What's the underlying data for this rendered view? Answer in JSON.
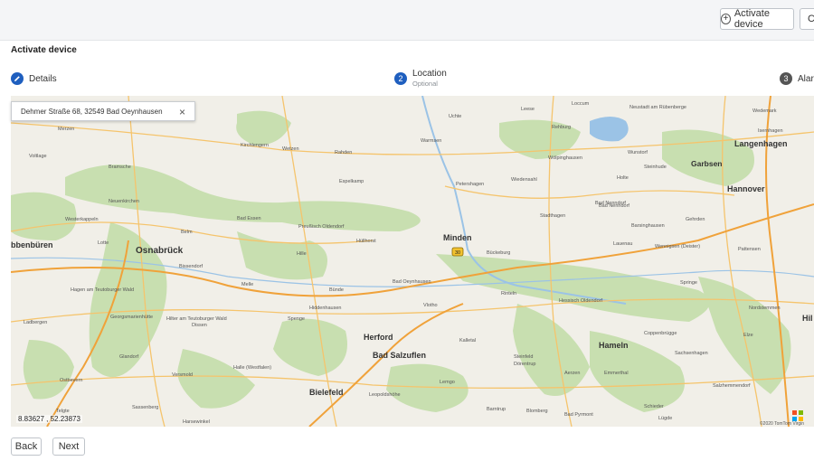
{
  "toolbar": {
    "activate_label": "Activate device",
    "second_label": "C"
  },
  "page": {
    "title": "Activate device"
  },
  "steps": [
    {
      "number": "",
      "label": "Details",
      "sublabel": ""
    },
    {
      "number": "2",
      "label": "Location",
      "sublabel": "Optional"
    },
    {
      "number": "3",
      "label": "Alarm",
      "sublabel": ""
    }
  ],
  "map": {
    "address": "Dehmer Straße 68, 32549 Bad Oeynhausen",
    "coordinates": "8.83627 , 52.23873",
    "copyright": "©2020 TomTom Virgin",
    "highway_shield": "30",
    "cities": [
      "Langenhagen",
      "Garbsen",
      "Hannover",
      "Osnabrück",
      "bbenbüren",
      "Minden",
      "Herford",
      "Bad Salzuflen",
      "Bielefeld",
      "Hameln",
      "Hil"
    ],
    "towns": [
      "Merzen",
      "Voltlage",
      "Bramsche",
      "Neuenkirchen",
      "Westerkappeln",
      "Lotte",
      "Belm",
      "Bissendorf",
      "Bad Essen",
      "Preußisch Oldendorf",
      "Hüllhorst",
      "Rahden",
      "Wetzen",
      "Espelkamp",
      "Uchte",
      "Warmsen",
      "Petershagen",
      "Wiedensahl",
      "Stadthagen",
      "Bad Nenndorf",
      "Barsinghausen",
      "Gehrden",
      "Wennigsen (Deister)",
      "Pattensen",
      "Springe",
      "Bückeburg",
      "Rinteln",
      "Vlotho",
      "Hiddenhausen",
      "Spenge",
      "Melle",
      "Hille",
      "Bünde",
      "Kirchlengern",
      "Bad Oeynhausen",
      "Bad Nenndorf",
      "Lauenau",
      "Hessisch Oldendorf",
      "Coppenbrügge",
      "Aerzen",
      "Emmerthal",
      "Kalletal",
      "Dörentrup",
      "Lemgo",
      "Leopoldshöhe",
      "Barntrup",
      "Blomberg",
      "Schieder",
      "Halle (Westfalen)",
      "Versmold",
      "Dissen",
      "Hagen am Teutoburger Wald",
      "Hilter am Teutoburger Wald",
      "Georgsmarienhütte",
      "Glandorf",
      "Ostbevern",
      "Ladbergen",
      "Sassenberg",
      "Telgte",
      "Harsewinkel",
      "Steinfeld",
      "Wunstorf",
      "Neustadt am Rübenberge",
      "Rehburg",
      "Leese",
      "Loccum",
      "Wölpinghausen",
      "Sachsenhagen",
      "Nordstemmen",
      "Elze",
      "Salzhemmendorf",
      "Bad Pyrmont",
      "Lügde",
      "Wedemark",
      "Isernhagen",
      "Holte",
      "Steinhude"
    ]
  },
  "footer": {
    "back_label": "Back",
    "next_label": "Next"
  },
  "colors": {
    "accent": "#1f5fbf",
    "forest": "#c8dfb0",
    "land": "#f1efe8",
    "water": "#9bc3e6",
    "road": "#f5c46c",
    "highway": "#f0a23a"
  }
}
